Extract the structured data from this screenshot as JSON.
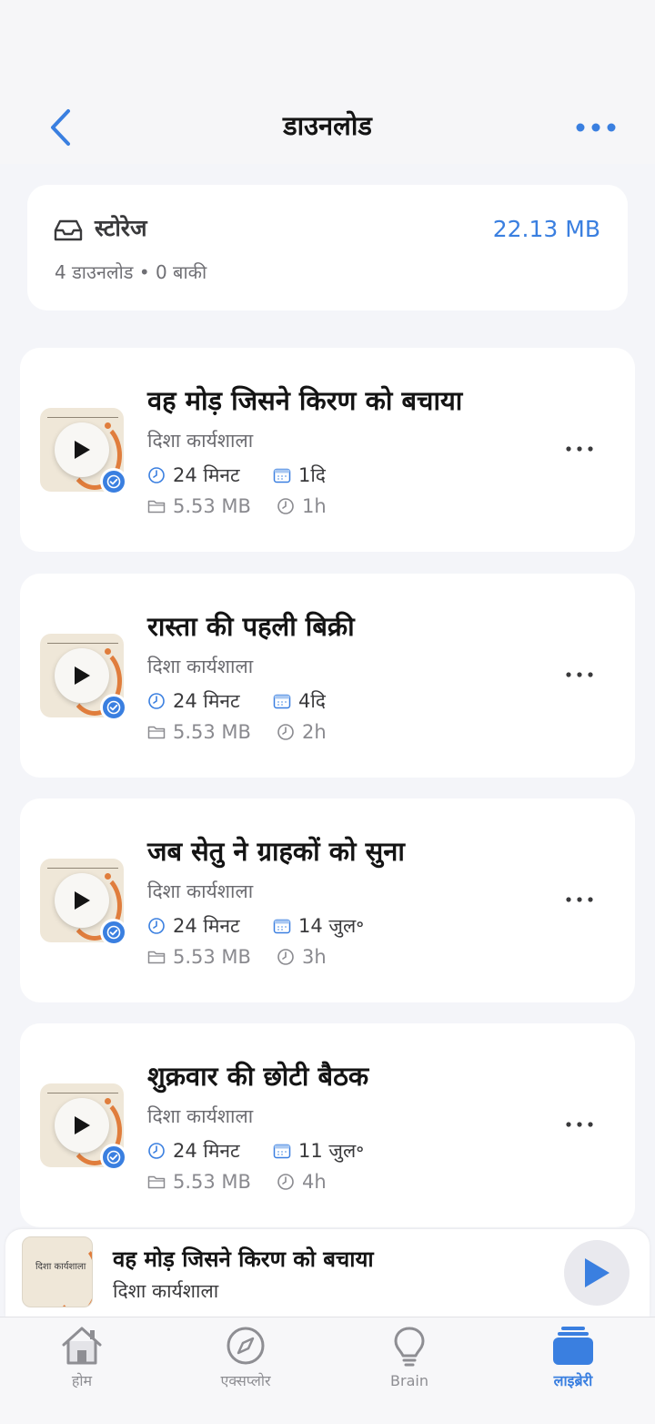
{
  "header": {
    "title": "डाउनलोड",
    "back_icon": "chevron-left-icon",
    "more_icon": "more-horizontal-icon",
    "accent": "#3a7fe0"
  },
  "storage": {
    "icon": "inbox-tray-icon",
    "title": "स्टोरेज",
    "size": "22.13 MB",
    "subtitle": "4 डाउनलोड • 0 बाकी"
  },
  "episodes": [
    {
      "title": "वह मोड़ जिसने किरण को बचाया",
      "author": "दिशा कार्यशाला",
      "duration": "24 मिनट",
      "date": "1दि",
      "file_size": "5.53 MB",
      "time_ago": "1h"
    },
    {
      "title": "रास्ता की पहली बिक्री",
      "author": "दिशा कार्यशाला",
      "duration": "24 मिनट",
      "date": "4दि",
      "file_size": "5.53 MB",
      "time_ago": "2h"
    },
    {
      "title": "जब सेतु ने ग्राहकों को सुना",
      "author": "दिशा कार्यशाला",
      "duration": "24 मिनट",
      "date": "14 जुल॰",
      "file_size": "5.53 MB",
      "time_ago": "3h"
    },
    {
      "title": "शुक्रवार की छोटी बैठक",
      "author": "दिशा कार्यशाला",
      "duration": "24 मिनट",
      "date": "11 जुल॰",
      "file_size": "5.53 MB",
      "time_ago": "4h"
    }
  ],
  "mini_player": {
    "title": "वह मोड़ जिसने किरण को बचाया",
    "author": "दिशा कार्यशाला",
    "thumb_text": "दिशा कार्यशाला"
  },
  "tabs": [
    {
      "label": "होम",
      "icon": "home-icon",
      "active": false
    },
    {
      "label": "एक्सप्लोर",
      "icon": "compass-icon",
      "active": false
    },
    {
      "label": "Brain",
      "icon": "lightbulb-icon",
      "active": false
    },
    {
      "label": "लाइब्रेरी",
      "icon": "library-icon",
      "active": true
    }
  ]
}
